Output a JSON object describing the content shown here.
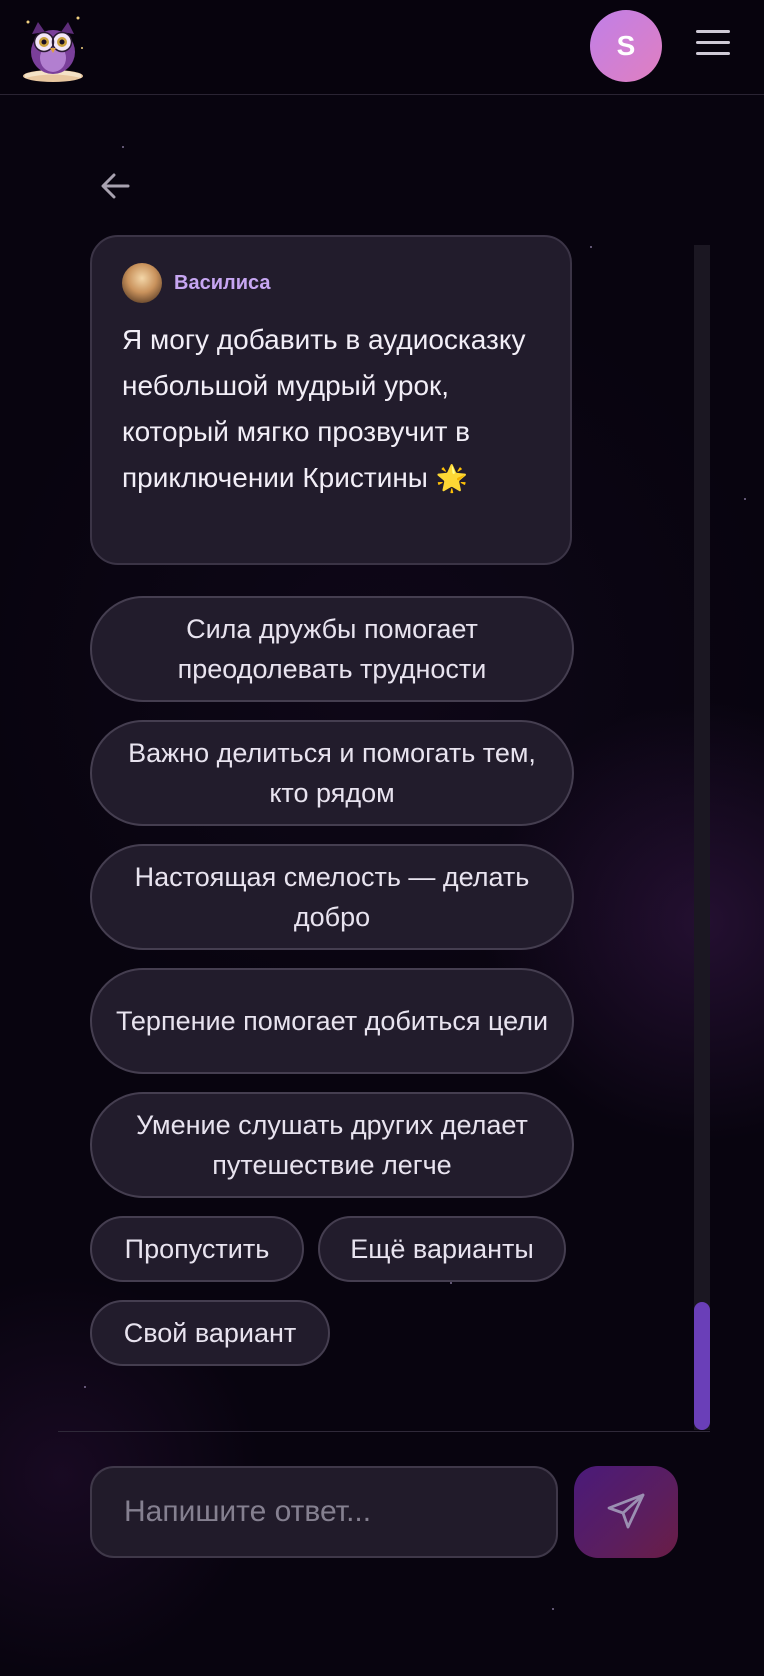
{
  "header": {
    "user_initial": "S"
  },
  "message": {
    "author": "Василиса",
    "text": "Я могу добавить в аудиосказку небольшой мудрый урок, который мягко прозвучит в приключении Кристины",
    "emoji": "🌟"
  },
  "options": [
    "Сила дружбы помогает преодолевать трудности",
    "Важно делиться и помогать тем, кто рядом",
    "Настоящая смелость — делать добро",
    "Терпение помогает добиться цели",
    "Умение слушать других делает путешествие легче"
  ],
  "actions": {
    "skip": "Пропустить",
    "more": "Ещё варианты",
    "custom": "Свой вариант"
  },
  "composer": {
    "placeholder": "Напишите ответ..."
  },
  "colors": {
    "background": "#08040f",
    "accent": "#6a3fb8",
    "author": "#c7a6f2",
    "avatar_gradient_start": "#c07fe8",
    "avatar_gradient_end": "#e07fc0"
  },
  "icons": {
    "logo": "owl-logo-icon",
    "menu": "hamburger-menu-icon",
    "back": "arrow-left-icon",
    "send": "paper-plane-icon"
  }
}
